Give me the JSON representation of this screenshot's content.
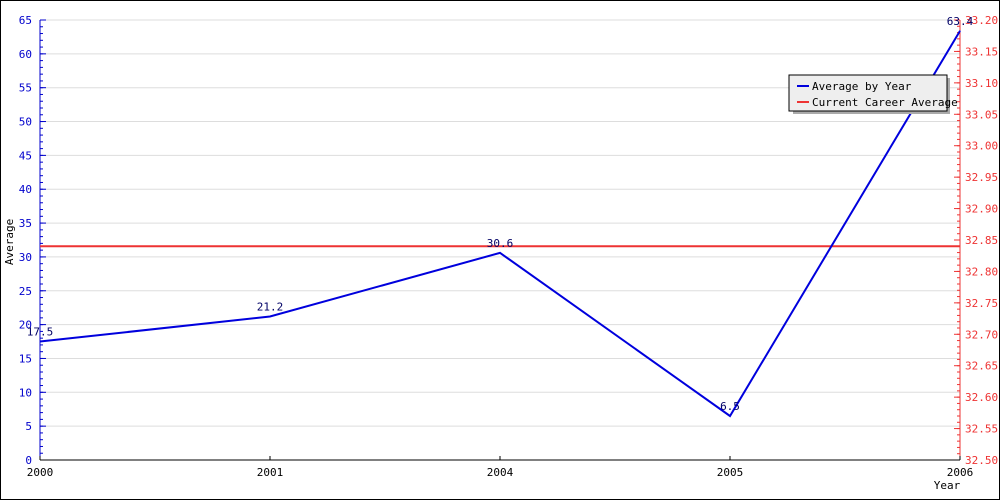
{
  "chart_data": {
    "type": "line",
    "title": "",
    "xlabel": "Year",
    "ylabel": "Average",
    "categories": [
      "2000",
      "2001",
      "2004",
      "2005",
      "2006"
    ],
    "series": [
      {
        "name": "Average by Year",
        "values": [
          17.5,
          21.2,
          30.6,
          6.5,
          63.4
        ],
        "color": "#0000dd",
        "axis": "left",
        "labels": [
          "17.5",
          "21.2",
          "30.6",
          "6.5",
          "63.4"
        ]
      },
      {
        "name": "Current Career Average",
        "value": 32.84,
        "color": "#ee3333",
        "axis": "right"
      }
    ],
    "ylim": [
      0,
      65
    ],
    "y_ticks": [
      0,
      5,
      10,
      15,
      20,
      25,
      30,
      35,
      40,
      45,
      50,
      55,
      60,
      65
    ],
    "y2lim": [
      32.5,
      33.2
    ],
    "y2_ticks": [
      "32.50",
      "32.55",
      "32.60",
      "32.65",
      "32.70",
      "32.75",
      "32.80",
      "32.85",
      "32.90",
      "32.95",
      "33.00",
      "33.05",
      "33.10",
      "33.15",
      "33.20"
    ],
    "grid": true,
    "legend": {
      "position": "top-right",
      "entries": [
        "Average by Year",
        "Current Career Average"
      ]
    },
    "colors": {
      "left_axis": "#0000cc",
      "right_axis": "#ee3333",
      "grid": "#dddddd",
      "legend_bg": "#eeeeee"
    }
  }
}
